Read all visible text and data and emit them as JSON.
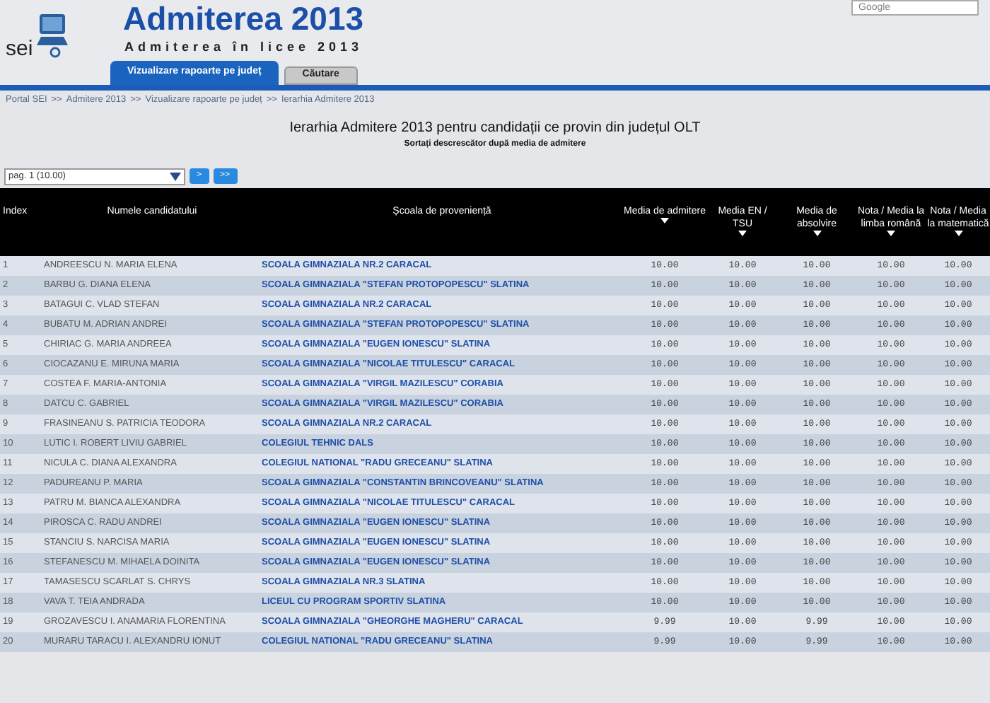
{
  "browser": {
    "search_placeholder": "Google"
  },
  "header": {
    "logo_text": "sei",
    "title": "Admiterea 2013",
    "subtitle": "Admiterea în licee 2013"
  },
  "tabs": [
    {
      "label": "Vizualizare rapoarte pe județ",
      "selected": true
    },
    {
      "label": "Căutare",
      "selected": false
    }
  ],
  "breadcrumb": [
    "Portal SEI",
    ">>",
    "Admitere 2013",
    ">>",
    "Vizualizare rapoarte pe județ",
    ">>",
    "Ierarhia Admitere 2013"
  ],
  "report": {
    "title": "Ierarhia Admitere 2013 pentru candidații ce provin din județul OLT",
    "subtitle": "Sortați descrescător după media de admitere"
  },
  "pager": {
    "page_select": "pag. 1 (10.00)",
    "buttons": [
      ">",
      ">>"
    ]
  },
  "table": {
    "columns": [
      {
        "label": "Index",
        "sortable": false
      },
      {
        "label": "Numele candidatului",
        "sortable": false
      },
      {
        "label": "Școala de proveniență",
        "sortable": false
      },
      {
        "label": "Media de admitere",
        "sortable": true
      },
      {
        "label": "Media EN / TSU",
        "sortable": true
      },
      {
        "label": "Media de absolvire",
        "sortable": true
      },
      {
        "label": "Nota / Media la limba română",
        "sortable": true
      },
      {
        "label": "Nota / Media la matematică",
        "sortable": true
      }
    ],
    "rows": [
      [
        "1",
        "ANDREESCU N. MARIA ELENA",
        "SCOALA GIMNAZIALA NR.2 CARACAL",
        "10.00",
        "10.00",
        "10.00",
        "10.00",
        "10.00"
      ],
      [
        "2",
        "BARBU G. DIANA ELENA",
        "SCOALA GIMNAZIALA \"STEFAN PROTOPOPESCU\" SLATINA",
        "10.00",
        "10.00",
        "10.00",
        "10.00",
        "10.00"
      ],
      [
        "3",
        "BATAGUI C. VLAD STEFAN",
        "SCOALA GIMNAZIALA NR.2 CARACAL",
        "10.00",
        "10.00",
        "10.00",
        "10.00",
        "10.00"
      ],
      [
        "4",
        "BUBATU M. ADRIAN ANDREI",
        "SCOALA GIMNAZIALA \"STEFAN PROTOPOPESCU\" SLATINA",
        "10.00",
        "10.00",
        "10.00",
        "10.00",
        "10.00"
      ],
      [
        "5",
        "CHIRIAC G. MARIA ANDREEA",
        "SCOALA GIMNAZIALA \"EUGEN IONESCU\" SLATINA",
        "10.00",
        "10.00",
        "10.00",
        "10.00",
        "10.00"
      ],
      [
        "6",
        "CIOCAZANU E. MIRUNA MARIA",
        "SCOALA GIMNAZIALA \"NICOLAE TITULESCU\" CARACAL",
        "10.00",
        "10.00",
        "10.00",
        "10.00",
        "10.00"
      ],
      [
        "7",
        "COSTEA F. MARIA-ANTONIA",
        "SCOALA GIMNAZIALA \"VIRGIL MAZILESCU\" CORABIA",
        "10.00",
        "10.00",
        "10.00",
        "10.00",
        "10.00"
      ],
      [
        "8",
        "DATCU C. GABRIEL",
        "SCOALA GIMNAZIALA \"VIRGIL MAZILESCU\" CORABIA",
        "10.00",
        "10.00",
        "10.00",
        "10.00",
        "10.00"
      ],
      [
        "9",
        "FRASINEANU S. PATRICIA TEODORA",
        "SCOALA GIMNAZIALA NR.2 CARACAL",
        "10.00",
        "10.00",
        "10.00",
        "10.00",
        "10.00"
      ],
      [
        "10",
        "LUTIC I. ROBERT LIVIU GABRIEL",
        "COLEGIUL TEHNIC DALS",
        "10.00",
        "10.00",
        "10.00",
        "10.00",
        "10.00"
      ],
      [
        "11",
        "NICULA C. DIANA ALEXANDRA",
        "COLEGIUL NATIONAL \"RADU GRECEANU\" SLATINA",
        "10.00",
        "10.00",
        "10.00",
        "10.00",
        "10.00"
      ],
      [
        "12",
        "PADUREANU P. MARIA",
        "SCOALA GIMNAZIALA \"CONSTANTIN BRINCOVEANU\" SLATINA",
        "10.00",
        "10.00",
        "10.00",
        "10.00",
        "10.00"
      ],
      [
        "13",
        "PATRU M. BIANCA ALEXANDRA",
        "SCOALA GIMNAZIALA \"NICOLAE TITULESCU\" CARACAL",
        "10.00",
        "10.00",
        "10.00",
        "10.00",
        "10.00"
      ],
      [
        "14",
        "PIROSCA C. RADU ANDREI",
        "SCOALA GIMNAZIALA \"EUGEN IONESCU\" SLATINA",
        "10.00",
        "10.00",
        "10.00",
        "10.00",
        "10.00"
      ],
      [
        "15",
        "STANCIU S. NARCISA MARIA",
        "SCOALA GIMNAZIALA \"EUGEN IONESCU\" SLATINA",
        "10.00",
        "10.00",
        "10.00",
        "10.00",
        "10.00"
      ],
      [
        "16",
        "STEFANESCU M. MIHAELA DOINITA",
        "SCOALA GIMNAZIALA \"EUGEN IONESCU\" SLATINA",
        "10.00",
        "10.00",
        "10.00",
        "10.00",
        "10.00"
      ],
      [
        "17",
        "TAMASESCU SCARLAT S. CHRYS",
        "SCOALA GIMNAZIALA NR.3 SLATINA",
        "10.00",
        "10.00",
        "10.00",
        "10.00",
        "10.00"
      ],
      [
        "18",
        "VAVA T. TEIA ANDRADA",
        "LICEUL CU PROGRAM SPORTIV SLATINA",
        "10.00",
        "10.00",
        "10.00",
        "10.00",
        "10.00"
      ],
      [
        "19",
        "GROZAVESCU I. ANAMARIA FLORENTINA",
        "SCOALA GIMNAZIALA \"GHEORGHE MAGHERU\" CARACAL",
        "9.99",
        "10.00",
        "9.99",
        "10.00",
        "10.00"
      ],
      [
        "20",
        "MURARU TARACU I. ALEXANDRU IONUT",
        "COLEGIUL NATIONAL \"RADU GRECEANU\" SLATINA",
        "9.99",
        "10.00",
        "9.99",
        "10.00",
        "10.00"
      ]
    ]
  }
}
